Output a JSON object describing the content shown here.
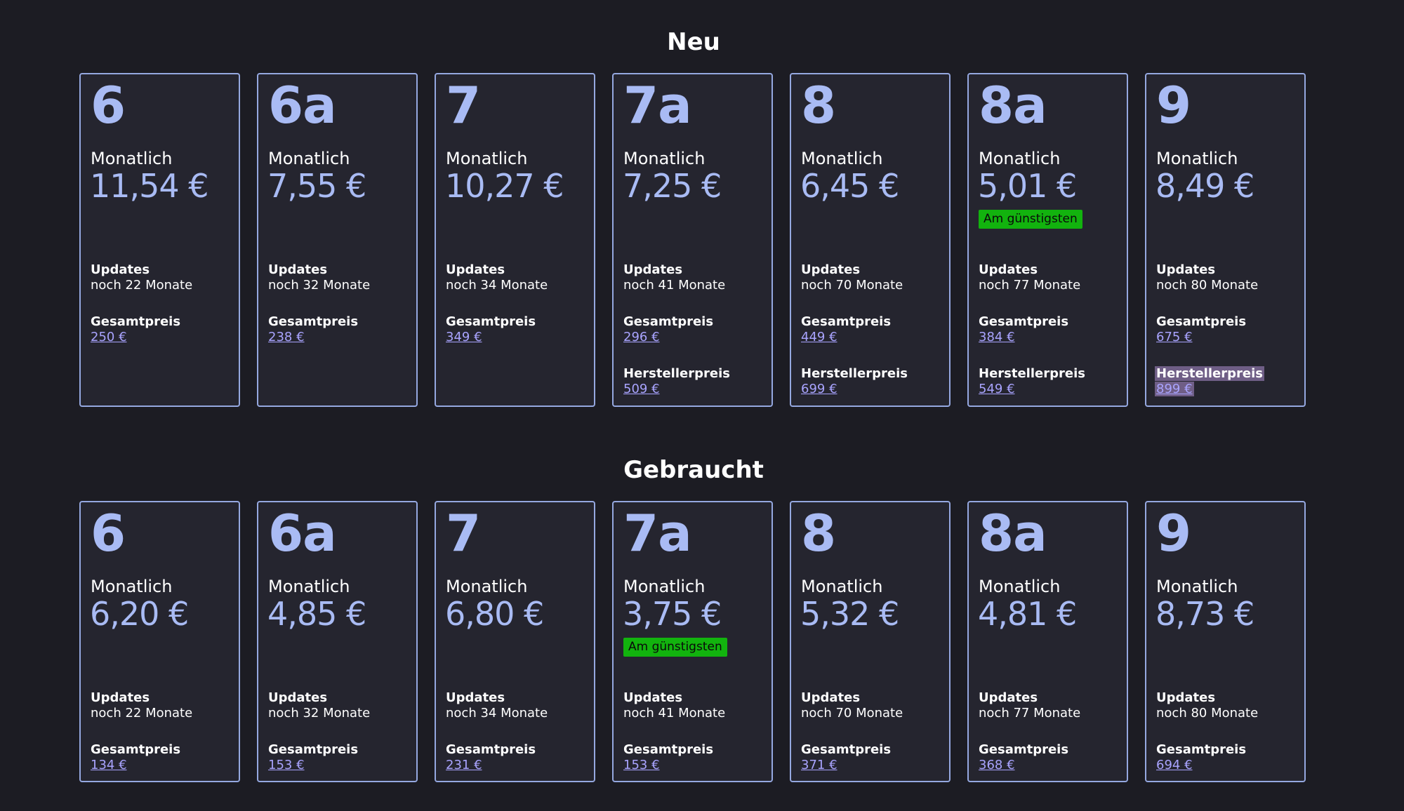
{
  "sections": [
    {
      "title": "Neu",
      "cards": [
        {
          "model": "6",
          "monthly_label": "Monatlich",
          "monthly": "11,54 €",
          "updates_label": "Updates",
          "updates": "noch 22 Monate",
          "total_label": "Gesamtpreis",
          "total": "250 €"
        },
        {
          "model": "6a",
          "monthly_label": "Monatlich",
          "monthly": "7,55 €",
          "updates_label": "Updates",
          "updates": "noch 32 Monate",
          "total_label": "Gesamtpreis",
          "total": "238 €"
        },
        {
          "model": "7",
          "monthly_label": "Monatlich",
          "monthly": "10,27 €",
          "updates_label": "Updates",
          "updates": "noch 34 Monate",
          "total_label": "Gesamtpreis",
          "total": "349 €"
        },
        {
          "model": "7a",
          "monthly_label": "Monatlich",
          "monthly": "7,25 €",
          "updates_label": "Updates",
          "updates": "noch 41 Monate",
          "total_label": "Gesamtpreis",
          "total": "296 €",
          "msrp_label": "Herstellerpreis",
          "msrp": "509 €"
        },
        {
          "model": "8",
          "monthly_label": "Monatlich",
          "monthly": "6,45 €",
          "updates_label": "Updates",
          "updates": "noch 70 Monate",
          "total_label": "Gesamtpreis",
          "total": "449 €",
          "msrp_label": "Herstellerpreis",
          "msrp": "699 €"
        },
        {
          "model": "8a",
          "monthly_label": "Monatlich",
          "monthly": "5,01 €",
          "badge": "Am günstigsten",
          "updates_label": "Updates",
          "updates": "noch 77 Monate",
          "total_label": "Gesamtpreis",
          "total": "384 €",
          "msrp_label": "Herstellerpreis",
          "msrp": "549 €"
        },
        {
          "model": "9",
          "monthly_label": "Monatlich",
          "monthly": "8,49 €",
          "updates_label": "Updates",
          "updates": "noch 80 Monate",
          "total_label": "Gesamtpreis",
          "total": "675 €",
          "msrp_label": "Herstellerpreis",
          "msrp": "899 €",
          "msrp_selected": true
        }
      ]
    },
    {
      "title": "Gebraucht",
      "cards": [
        {
          "model": "6",
          "monthly_label": "Monatlich",
          "monthly": "6,20 €",
          "updates_label": "Updates",
          "updates": "noch 22 Monate",
          "total_label": "Gesamtpreis",
          "total": "134 €"
        },
        {
          "model": "6a",
          "monthly_label": "Monatlich",
          "monthly": "4,85 €",
          "updates_label": "Updates",
          "updates": "noch 32 Monate",
          "total_label": "Gesamtpreis",
          "total": "153 €"
        },
        {
          "model": "7",
          "monthly_label": "Monatlich",
          "monthly": "6,80 €",
          "updates_label": "Updates",
          "updates": "noch 34 Monate",
          "total_label": "Gesamtpreis",
          "total": "231 €"
        },
        {
          "model": "7a",
          "monthly_label": "Monatlich",
          "monthly": "3,75 €",
          "badge": "Am günstigsten",
          "updates_label": "Updates",
          "updates": "noch 41 Monate",
          "total_label": "Gesamtpreis",
          "total": "153 €"
        },
        {
          "model": "8",
          "monthly_label": "Monatlich",
          "monthly": "5,32 €",
          "updates_label": "Updates",
          "updates": "noch 70 Monate",
          "total_label": "Gesamtpreis",
          "total": "371 €"
        },
        {
          "model": "8a",
          "monthly_label": "Monatlich",
          "monthly": "4,81 €",
          "updates_label": "Updates",
          "updates": "noch 77 Monate",
          "total_label": "Gesamtpreis",
          "total": "368 €"
        },
        {
          "model": "9",
          "monthly_label": "Monatlich",
          "monthly": "8,73 €",
          "updates_label": "Updates",
          "updates": "noch 80 Monate",
          "total_label": "Gesamtpreis",
          "total": "694 €"
        }
      ]
    }
  ]
}
